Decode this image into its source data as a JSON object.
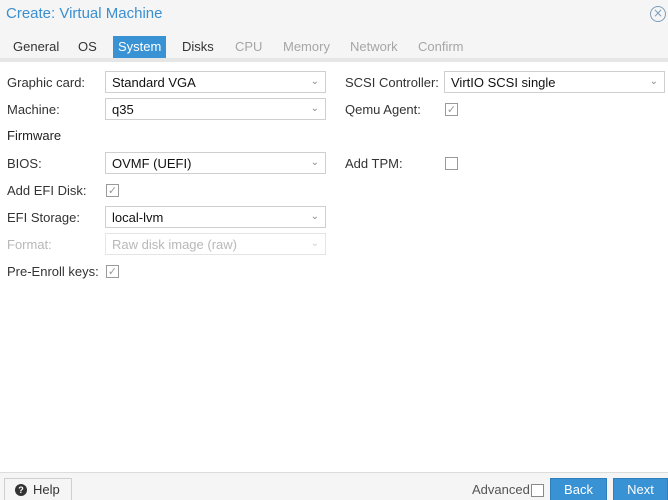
{
  "window": {
    "title": "Create: Virtual Machine",
    "close_icon": "circle-x-icon"
  },
  "tabs": [
    {
      "label": "General",
      "state": "normal"
    },
    {
      "label": "OS",
      "state": "normal"
    },
    {
      "label": "System",
      "state": "active"
    },
    {
      "label": "Disks",
      "state": "normal"
    },
    {
      "label": "CPU",
      "state": "disabled"
    },
    {
      "label": "Memory",
      "state": "disabled"
    },
    {
      "label": "Network",
      "state": "disabled"
    },
    {
      "label": "Confirm",
      "state": "disabled"
    }
  ],
  "form": {
    "graphic_card": {
      "label": "Graphic card:",
      "value": "Standard VGA"
    },
    "machine": {
      "label": "Machine:",
      "value": "q35"
    },
    "firmware_title": "Firmware",
    "bios": {
      "label": "BIOS:",
      "value": "OVMF (UEFI)"
    },
    "add_efi_disk": {
      "label": "Add EFI Disk:",
      "checked": true
    },
    "efi_storage": {
      "label": "EFI Storage:",
      "value": "local-lvm"
    },
    "format": {
      "label": "Format:",
      "value": "Raw disk image (raw)",
      "disabled": true
    },
    "pre_enroll_keys": {
      "label": "Pre-Enroll keys:",
      "checked": true
    },
    "scsi_controller": {
      "label": "SCSI Controller:",
      "value": "VirtIO SCSI single"
    },
    "qemu_agent": {
      "label": "Qemu Agent:",
      "checked": true
    },
    "add_tpm": {
      "label": "Add TPM:",
      "checked": false
    }
  },
  "footer": {
    "help_label": "Help",
    "help_icon": "question-circle-icon",
    "advanced_label": "Advanced",
    "advanced_checked": false,
    "back_label": "Back",
    "next_label": "Next"
  },
  "colors": {
    "accent": "#3892d4",
    "title": "#3a8fd0",
    "disabled_text": "#a6a6a6"
  }
}
